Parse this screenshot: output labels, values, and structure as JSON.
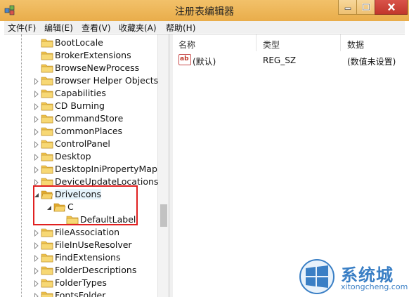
{
  "window": {
    "title": "注册表编辑器"
  },
  "menu": [
    "文件(F)",
    "编辑(E)",
    "查看(V)",
    "收藏夹(A)",
    "帮助(H)"
  ],
  "tree": {
    "nodes": [
      {
        "label": "BootLocale",
        "expander": "none"
      },
      {
        "label": "BrokerExtensions",
        "expander": "none"
      },
      {
        "label": "BrowseNewProcess",
        "expander": "none"
      },
      {
        "label": "Browser Helper Objects",
        "expander": "collapsed"
      },
      {
        "label": "Capabilities",
        "expander": "collapsed"
      },
      {
        "label": "CD Burning",
        "expander": "collapsed"
      },
      {
        "label": "CommandStore",
        "expander": "collapsed"
      },
      {
        "label": "CommonPlaces",
        "expander": "collapsed"
      },
      {
        "label": "ControlPanel",
        "expander": "collapsed"
      },
      {
        "label": "Desktop",
        "expander": "collapsed"
      },
      {
        "label": "DesktopIniPropertyMap",
        "expander": "collapsed"
      },
      {
        "label": "DeviceUpdateLocations",
        "expander": "collapsed"
      },
      {
        "label": "DriveIcons",
        "expander": "expanded"
      },
      {
        "label": "C",
        "expander": "expanded"
      },
      {
        "label": "DefaultLabel",
        "expander": "none"
      },
      {
        "label": "FileAssociation",
        "expander": "collapsed"
      },
      {
        "label": "FileInUseResolver",
        "expander": "collapsed"
      },
      {
        "label": "FindExtensions",
        "expander": "collapsed"
      },
      {
        "label": "FolderDescriptions",
        "expander": "collapsed"
      },
      {
        "label": "FolderTypes",
        "expander": "collapsed"
      },
      {
        "label": "FontsFolder",
        "expander": "collapsed"
      }
    ]
  },
  "list": {
    "columns": [
      "名称",
      "类型",
      "数据"
    ],
    "rows": [
      {
        "name": "(默认)",
        "type": "REG_SZ",
        "data": "(数值未设置)",
        "icon": "string-value-icon"
      }
    ]
  },
  "watermark": {
    "brand": "系统城",
    "url": "xitongcheng.com"
  },
  "colors": {
    "titlebar": "#eeb85c",
    "close": "#c9413a",
    "highlight": "#e02020",
    "folder": "#f2c64f"
  }
}
